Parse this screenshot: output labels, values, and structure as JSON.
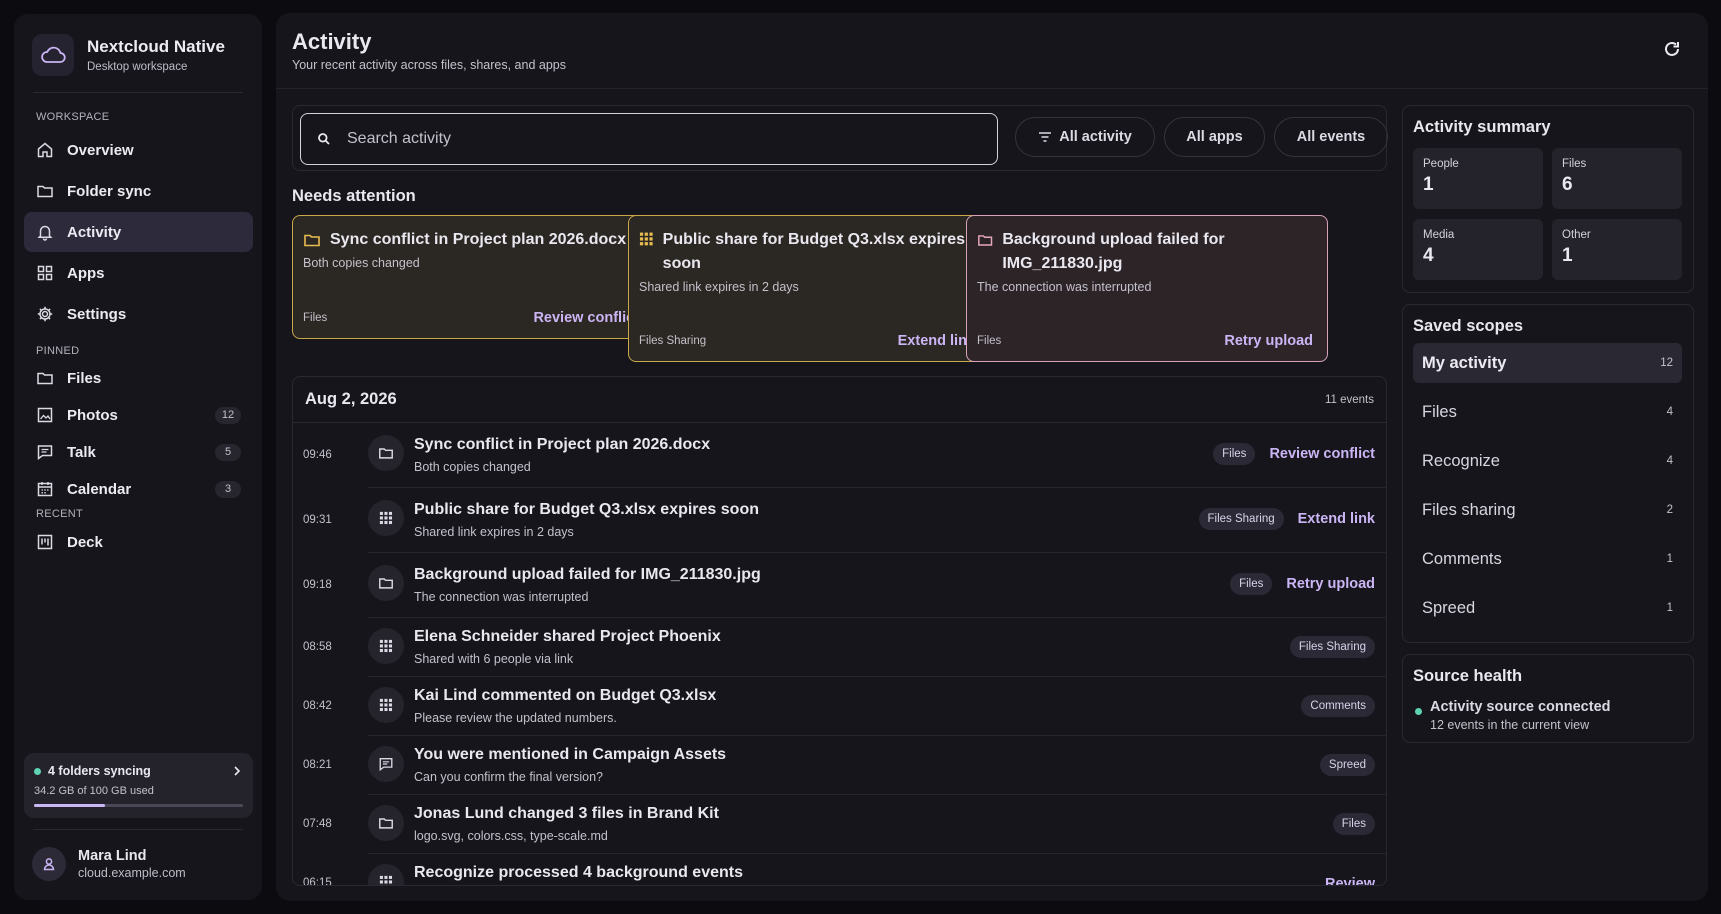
{
  "brand": {
    "title": "Nextcloud Native",
    "subtitle": "Desktop workspace"
  },
  "sidebar": {
    "sections": {
      "workspace": "WORKSPACE",
      "pinned": "PINNED",
      "recent": "RECENT"
    },
    "workspace": [
      {
        "label": "Overview",
        "icon": "home-icon"
      },
      {
        "label": "Folder sync",
        "icon": "folder-icon"
      },
      {
        "label": "Activity",
        "icon": "bell-icon",
        "active": true
      },
      {
        "label": "Apps",
        "icon": "grid-icon"
      },
      {
        "label": "Settings",
        "icon": "gear-icon"
      }
    ],
    "pinned": [
      {
        "label": "Files",
        "icon": "folder-icon"
      },
      {
        "label": "Photos",
        "icon": "photo-icon",
        "count": "12"
      },
      {
        "label": "Talk",
        "icon": "chat-icon",
        "count": "5"
      },
      {
        "label": "Calendar",
        "icon": "calendar-icon",
        "count": "3"
      }
    ],
    "recent": [
      {
        "label": "Deck",
        "icon": "deck-icon"
      }
    ],
    "sync": {
      "title": "4 folders syncing",
      "usage": "34.2 GB of 100 GB used",
      "used_fraction": 0.342
    },
    "user": {
      "name": "Mara Lind",
      "server": "cloud.example.com"
    }
  },
  "header": {
    "title": "Activity",
    "subtitle": "Your recent activity across files, shares, and apps"
  },
  "filters": {
    "search_placeholder": "Search activity",
    "activity": "All activity",
    "apps": "All apps",
    "events": "All events"
  },
  "attention": {
    "title": "Needs attention",
    "cards": [
      {
        "title": "Sync conflict in Project plan 2026.docx",
        "sub": "Both copies changed",
        "app": "Files",
        "action": "Review conflict",
        "icon": "folder-icon"
      },
      {
        "title": "Public share for Budget Q3.xlsx expires soon",
        "sub": "Shared link expires in 2 days",
        "app": "Files Sharing",
        "action": "Extend link",
        "icon": "grid-icon"
      },
      {
        "title": "Background upload failed for IMG_211830.jpg",
        "sub": "The connection was interrupted",
        "app": "Files",
        "action": "Retry upload",
        "icon": "folder-icon"
      }
    ]
  },
  "list": {
    "date": "Aug 2, 2026",
    "count": "11 events",
    "rows": [
      {
        "time": "09:46",
        "title": "Sync conflict in Project plan 2026.docx",
        "sub": "Both copies changed",
        "tag": "Files",
        "action": "Review conflict",
        "icon": "folder-icon"
      },
      {
        "time": "09:31",
        "title": "Public share for Budget Q3.xlsx expires soon",
        "sub": "Shared link expires in 2 days",
        "tag": "Files Sharing",
        "action": "Extend link",
        "icon": "grid-icon"
      },
      {
        "time": "09:18",
        "title": "Background upload failed for IMG_211830.jpg",
        "sub": "The connection was interrupted",
        "tag": "Files",
        "action": "Retry upload",
        "icon": "folder-icon"
      },
      {
        "time": "08:58",
        "title": "Elena Schneider shared Project Phoenix",
        "sub": "Shared with 6 people via link",
        "tag": "Files Sharing",
        "action": "",
        "icon": "grid-icon"
      },
      {
        "time": "08:42",
        "title": "Kai Lind commented on Budget Q3.xlsx",
        "sub": "Please review the updated numbers.",
        "tag": "Comments",
        "action": "",
        "icon": "grid-icon"
      },
      {
        "time": "08:21",
        "title": "You were mentioned in Campaign Assets",
        "sub": "Can you confirm the final version?",
        "tag": "Spreed",
        "action": "",
        "icon": "chat-icon"
      },
      {
        "time": "07:48",
        "title": "Jonas Lund changed 3 files in Brand Kit",
        "sub": "logo.svg, colors.css, type-scale.md",
        "tag": "Files",
        "action": "",
        "icon": "folder-icon"
      },
      {
        "time": "06:15",
        "title": "Recognize processed 4 background events",
        "sub": "",
        "tag": "",
        "action": "Review",
        "icon": "grid-icon"
      }
    ]
  },
  "summary": {
    "title": "Activity summary",
    "stats": [
      {
        "label": "People",
        "value": "1"
      },
      {
        "label": "Files",
        "value": "6"
      },
      {
        "label": "Media",
        "value": "4"
      },
      {
        "label": "Other",
        "value": "1"
      }
    ]
  },
  "scopes": {
    "title": "Saved scopes",
    "items": [
      {
        "label": "My activity",
        "count": "12",
        "active": true
      },
      {
        "label": "Files",
        "count": "4"
      },
      {
        "label": "Recognize",
        "count": "4"
      },
      {
        "label": "Files sharing",
        "count": "2"
      },
      {
        "label": "Comments",
        "count": "1"
      },
      {
        "label": "Spreed",
        "count": "1"
      }
    ]
  },
  "health": {
    "title": "Source health",
    "status": "Activity source connected",
    "detail": "12 events in the current view"
  },
  "colors": {
    "accent": "#cbb5f4",
    "status_ok": "#5ed3b2",
    "warning_border": "#c9a84a",
    "error_border": "#d6a3b8"
  }
}
